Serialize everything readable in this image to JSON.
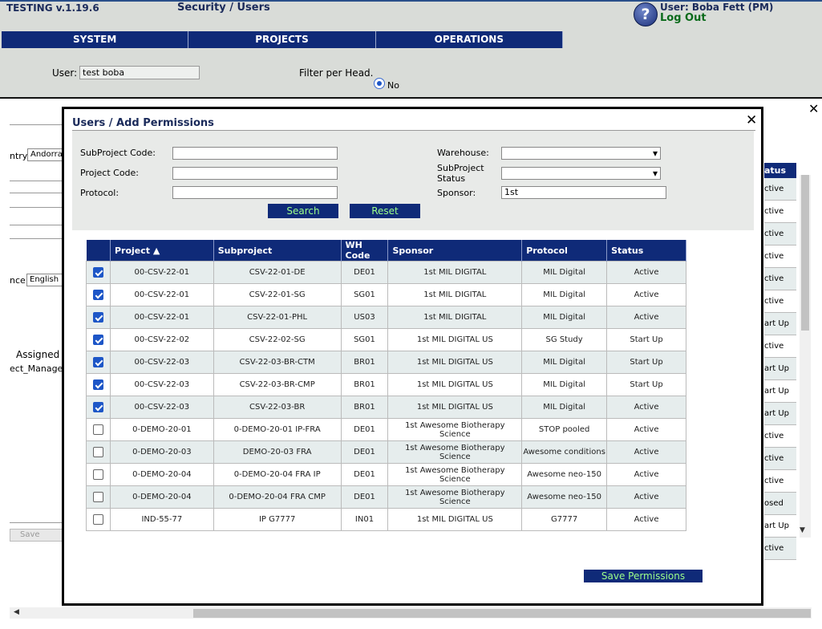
{
  "header": {
    "app_version": "TESTING v.1.19.6",
    "page_title": "Security / Users",
    "user_label": "User: Boba Fett (PM)",
    "logout_label": "Log Out",
    "help_glyph": "?"
  },
  "menu": {
    "items": [
      {
        "label": "SYSTEM"
      },
      {
        "label": "PROJECTS"
      },
      {
        "label": "OPERATIONS"
      }
    ]
  },
  "user_filter": {
    "user_label": "User:",
    "user_value": "test boba",
    "filter_label": "Filter per Head.",
    "radio_no_label": "No"
  },
  "background_panel": {
    "close_glyph": "✕",
    "country_label": "ntry",
    "country_value": "Andorra",
    "language_label": "nce",
    "language_value": "English",
    "assigned_label": "Assigned P",
    "role_value": "ect_Manager",
    "save_label": "Save",
    "status_header": "atus",
    "statuses": [
      "ctive",
      "ctive",
      "ctive",
      "ctive",
      "ctive",
      "ctive",
      "art Up",
      "ctive",
      "art Up",
      "art Up",
      "art Up",
      "ctive",
      "ctive",
      "ctive",
      "osed",
      "art Up",
      "ctive"
    ]
  },
  "modal": {
    "title": "Users / Add Permissions",
    "close_glyph": "✕",
    "filters": {
      "subproject_code_label": "SubProject Code:",
      "subproject_code_value": "",
      "project_code_label": "Project Code:",
      "project_code_value": "",
      "protocol_label": "Protocol:",
      "protocol_value": "",
      "warehouse_label": "Warehouse:",
      "warehouse_value": "",
      "subproject_status_label_1": "SubProject",
      "subproject_status_label_2": "Status",
      "subproject_status_value": "",
      "sponsor_label": "Sponsor:",
      "sponsor_value": "1st",
      "search_label": "Search",
      "reset_label": "Reset"
    },
    "table": {
      "columns": [
        "",
        "Project ▲",
        "Subproject",
        "WH Code",
        "Sponsor",
        "Protocol",
        "Status"
      ],
      "rows": [
        {
          "checked": true,
          "project": "00-CSV-22-01",
          "subproject": "CSV-22-01-DE",
          "wh": "DE01",
          "sponsor": "1st MIL DIGITAL",
          "protocol": "MIL Digital",
          "status": "Active"
        },
        {
          "checked": true,
          "project": "00-CSV-22-01",
          "subproject": "CSV-22-01-SG",
          "wh": "SG01",
          "sponsor": "1st MIL DIGITAL",
          "protocol": "MIL Digital",
          "status": "Active"
        },
        {
          "checked": true,
          "project": "00-CSV-22-01",
          "subproject": "CSV-22-01-PHL",
          "wh": "US03",
          "sponsor": "1st MIL DIGITAL",
          "protocol": "MIL Digital",
          "status": "Active"
        },
        {
          "checked": true,
          "project": "00-CSV-22-02",
          "subproject": "CSV-22-02-SG",
          "wh": "SG01",
          "sponsor": "1st MIL DIGITAL US",
          "protocol": "SG Study",
          "status": "Start Up"
        },
        {
          "checked": true,
          "project": "00-CSV-22-03",
          "subproject": "CSV-22-03-BR-CTM",
          "wh": "BR01",
          "sponsor": "1st MIL DIGITAL US",
          "protocol": "MIL Digital",
          "status": "Start Up"
        },
        {
          "checked": true,
          "project": "00-CSV-22-03",
          "subproject": "CSV-22-03-BR-CMP",
          "wh": "BR01",
          "sponsor": "1st MIL DIGITAL US",
          "protocol": "MIL Digital",
          "status": "Start Up"
        },
        {
          "checked": true,
          "project": "00-CSV-22-03",
          "subproject": "CSV-22-03-BR",
          "wh": "BR01",
          "sponsor": "1st MIL DIGITAL US",
          "protocol": "MIL Digital",
          "status": "Active"
        },
        {
          "checked": false,
          "project": "0-DEMO-20-01",
          "subproject": "0-DEMO-20-01 IP-FRA",
          "wh": "DE01",
          "sponsor": "1st Awesome Biotherapy Science",
          "protocol": "STOP pooled",
          "status": "Active"
        },
        {
          "checked": false,
          "project": "0-DEMO-20-03",
          "subproject": "DEMO-20-03 FRA",
          "wh": "DE01",
          "sponsor": "1st Awesome Biotherapy Science",
          "protocol": "Awesome conditions",
          "status": "Active"
        },
        {
          "checked": false,
          "project": "0-DEMO-20-04",
          "subproject": "0-DEMO-20-04 FRA IP",
          "wh": "DE01",
          "sponsor": "1st Awesome Biotherapy Science",
          "protocol": "Awesome neo-150",
          "status": "Active"
        },
        {
          "checked": false,
          "project": "0-DEMO-20-04",
          "subproject": "0-DEMO-20-04 FRA CMP",
          "wh": "DE01",
          "sponsor": "1st Awesome Biotherapy Science",
          "protocol": "Awesome neo-150",
          "status": "Active"
        },
        {
          "checked": false,
          "project": "IND-55-77",
          "subproject": "IP G7777",
          "wh": "IN01",
          "sponsor": "1st MIL DIGITAL US",
          "protocol": "G7777",
          "status": "Active"
        }
      ]
    },
    "save_label": "Save Permissions"
  },
  "colors": {
    "nav": "#0f2a78",
    "button_text": "#9dff8a",
    "row_alt": "#e6eded"
  }
}
